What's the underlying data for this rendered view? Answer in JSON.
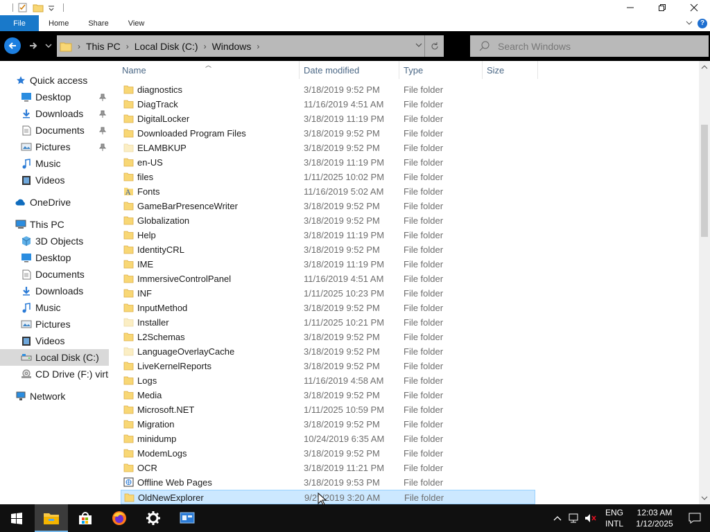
{
  "ribbon": {
    "tabs": [
      "File",
      "Home",
      "Share",
      "View"
    ]
  },
  "address": {
    "crumbs": [
      "This PC",
      "Local Disk (C:)",
      "Windows"
    ]
  },
  "search": {
    "placeholder": "Search Windows"
  },
  "nav": {
    "items": [
      {
        "label": "Quick access",
        "icon": "star-icon"
      },
      {
        "label": "Desktop",
        "icon": "desktop-icon",
        "pinned": true
      },
      {
        "label": "Downloads",
        "icon": "downloads-icon",
        "pinned": true
      },
      {
        "label": "Documents",
        "icon": "documents-icon",
        "pinned": true
      },
      {
        "label": "Pictures",
        "icon": "pictures-icon",
        "pinned": true
      },
      {
        "label": "Music",
        "icon": "music-icon"
      },
      {
        "label": "Videos",
        "icon": "videos-icon"
      },
      {
        "label": "OneDrive",
        "icon": "cloud-icon"
      },
      {
        "label": "This PC",
        "icon": "computer-icon"
      },
      {
        "label": "3D Objects",
        "icon": "cube-icon"
      },
      {
        "label": "Desktop",
        "icon": "desktop-icon"
      },
      {
        "label": "Documents",
        "icon": "documents-icon"
      },
      {
        "label": "Downloads",
        "icon": "downloads-icon"
      },
      {
        "label": "Music",
        "icon": "music-icon"
      },
      {
        "label": "Pictures",
        "icon": "pictures-icon"
      },
      {
        "label": "Videos",
        "icon": "videos-icon"
      },
      {
        "label": "Local Disk (C:)",
        "icon": "drive-icon",
        "selected": true
      },
      {
        "label": "CD Drive (F:) virtio",
        "icon": "cd-drive-icon"
      },
      {
        "label": "Network",
        "icon": "network-icon"
      }
    ]
  },
  "columns": {
    "name": "Name",
    "date": "Date modified",
    "type": "Type",
    "size": "Size"
  },
  "files": [
    {
      "name": "diagnostics",
      "date": "3/18/2019 9:52 PM",
      "type": "File folder"
    },
    {
      "name": "DiagTrack",
      "date": "11/16/2019 4:51 AM",
      "type": "File folder"
    },
    {
      "name": "DigitalLocker",
      "date": "3/18/2019 11:19 PM",
      "type": "File folder"
    },
    {
      "name": "Downloaded Program Files",
      "date": "3/18/2019 9:52 PM",
      "type": "File folder"
    },
    {
      "name": "ELAMBKUP",
      "date": "3/18/2019 9:52 PM",
      "type": "File folder",
      "icon": "faded"
    },
    {
      "name": "en-US",
      "date": "3/18/2019 11:19 PM",
      "type": "File folder"
    },
    {
      "name": "files",
      "date": "1/11/2025 10:02 PM",
      "type": "File folder"
    },
    {
      "name": "Fonts",
      "date": "11/16/2019 5:02 AM",
      "type": "File folder",
      "icon": "fonts"
    },
    {
      "name": "GameBarPresenceWriter",
      "date": "3/18/2019 9:52 PM",
      "type": "File folder"
    },
    {
      "name": "Globalization",
      "date": "3/18/2019 9:52 PM",
      "type": "File folder"
    },
    {
      "name": "Help",
      "date": "3/18/2019 11:19 PM",
      "type": "File folder"
    },
    {
      "name": "IdentityCRL",
      "date": "3/18/2019 9:52 PM",
      "type": "File folder"
    },
    {
      "name": "IME",
      "date": "3/18/2019 11:19 PM",
      "type": "File folder"
    },
    {
      "name": "ImmersiveControlPanel",
      "date": "11/16/2019 4:51 AM",
      "type": "File folder"
    },
    {
      "name": "INF",
      "date": "1/11/2025 10:23 PM",
      "type": "File folder"
    },
    {
      "name": "InputMethod",
      "date": "3/18/2019 9:52 PM",
      "type": "File folder"
    },
    {
      "name": "Installer",
      "date": "1/11/2025 10:21 PM",
      "type": "File folder",
      "icon": "faded"
    },
    {
      "name": "L2Schemas",
      "date": "3/18/2019 9:52 PM",
      "type": "File folder"
    },
    {
      "name": "LanguageOverlayCache",
      "date": "3/18/2019 9:52 PM",
      "type": "File folder",
      "icon": "faded"
    },
    {
      "name": "LiveKernelReports",
      "date": "3/18/2019 9:52 PM",
      "type": "File folder"
    },
    {
      "name": "Logs",
      "date": "11/16/2019 4:58 AM",
      "type": "File folder"
    },
    {
      "name": "Media",
      "date": "3/18/2019 9:52 PM",
      "type": "File folder"
    },
    {
      "name": "Microsoft.NET",
      "date": "1/11/2025 10:59 PM",
      "type": "File folder"
    },
    {
      "name": "Migration",
      "date": "3/18/2019 9:52 PM",
      "type": "File folder"
    },
    {
      "name": "minidump",
      "date": "10/24/2019 6:35 AM",
      "type": "File folder"
    },
    {
      "name": "ModemLogs",
      "date": "3/18/2019 9:52 PM",
      "type": "File folder"
    },
    {
      "name": "OCR",
      "date": "3/18/2019 11:21 PM",
      "type": "File folder"
    },
    {
      "name": "Offline Web Pages",
      "date": "3/18/2019 9:53 PM",
      "type": "File folder",
      "icon": "web"
    },
    {
      "name": "OldNewExplorer",
      "date": "9/2?/2019 3:20 AM",
      "type": "File folder",
      "selected": true
    }
  ],
  "tray": {
    "lang_top": "ENG",
    "lang_bottom": "INTL",
    "time": "12:03 AM",
    "date": "1/12/2025"
  },
  "colors": {
    "accent": "#1979ca",
    "selection": "#cce8ff",
    "folder": "#f8d775"
  }
}
